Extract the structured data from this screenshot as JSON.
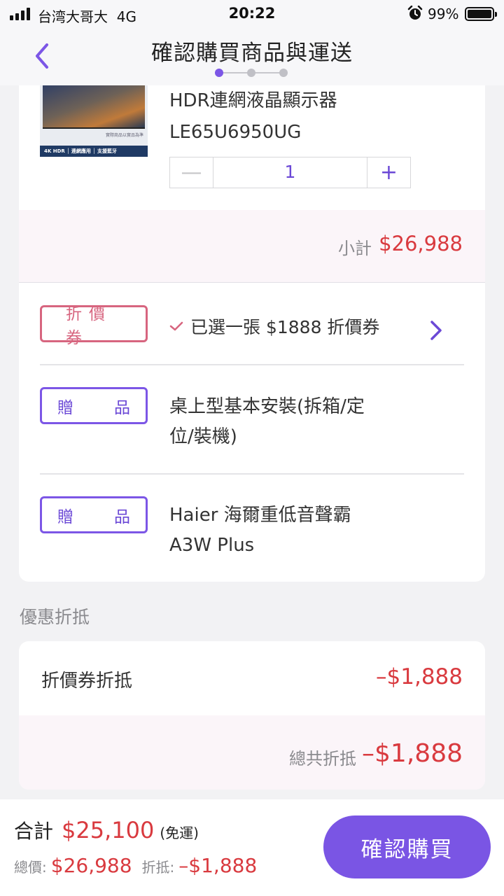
{
  "status_bar": {
    "carrier": "台湾大哥大",
    "network": "4G",
    "time": "20:22",
    "battery_percent": "99%"
  },
  "header": {
    "title": "確認購買商品與運送",
    "step_current": 1,
    "step_total": 3
  },
  "product": {
    "image_strip_text": "4K HDR │ 連網應用 │ 支援藍牙",
    "image_caption": "實際商品以實品為準",
    "name_line1": "HDR連網液晶顯示器",
    "name_line2": "LE65U6950UG",
    "quantity": "1",
    "minus_symbol": "—",
    "plus_symbol": "+",
    "subtotal_label": "小計",
    "subtotal_value": "$26,988"
  },
  "coupon": {
    "tag": "折價券",
    "selected_text": "已選一張 $1888 折價券"
  },
  "gifts": [
    {
      "tag_left": "贈",
      "tag_right": "品",
      "line1": "桌上型基本安裝(拆箱/定",
      "line2": "位/裝機)"
    },
    {
      "tag_left": "贈",
      "tag_right": "品",
      "line1": "Haier 海爾重低音聲霸",
      "line2": "A3W Plus"
    }
  ],
  "discount": {
    "section_title": "優惠折抵",
    "coupon_label": "折價券折抵",
    "coupon_value": "–$1,888",
    "total_label": "總共折抵",
    "total_value": "–$1,888"
  },
  "bottom": {
    "total_label": "合計",
    "total_value": "$25,100",
    "shipping_note": "(免運)",
    "price_label": "總價:",
    "price_value": "$26,988",
    "discount_label": "折抵:",
    "discount_value": "–$1,888",
    "confirm_label": "確認購買"
  },
  "colors": {
    "accent": "#7a55e4",
    "price_red": "#d93a3f",
    "coupon_pink": "#d7657f",
    "highlight_bg": "#fbf5f9"
  },
  "icons": [
    "back-chevron-icon",
    "check-icon",
    "chevron-right-icon",
    "alarm-icon",
    "battery-icon",
    "signal-icon"
  ]
}
